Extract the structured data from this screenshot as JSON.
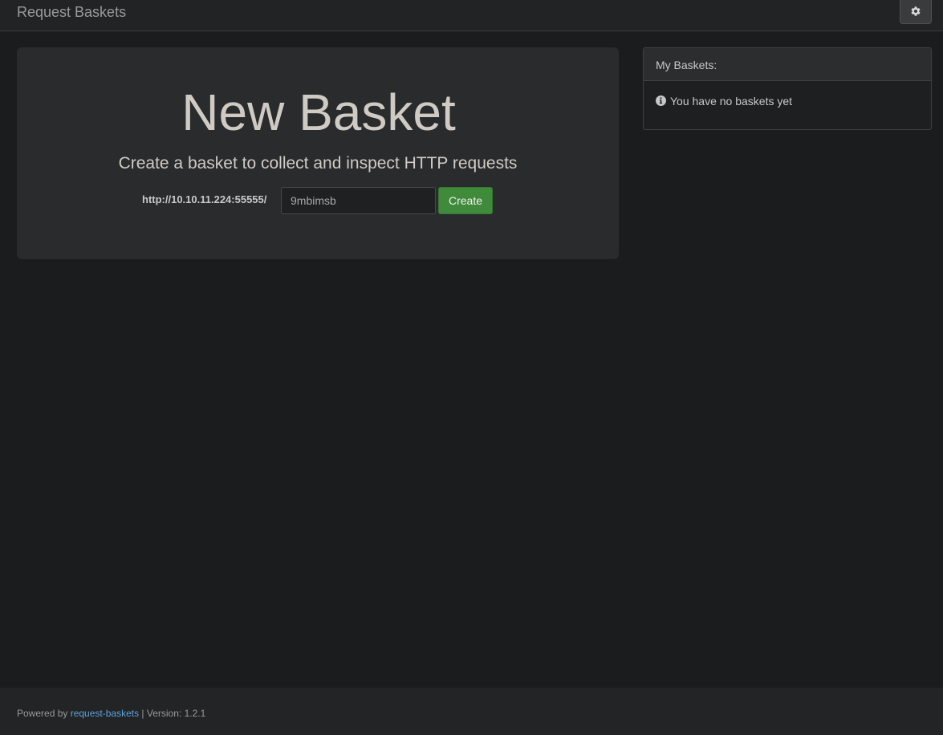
{
  "navbar": {
    "brand": "Request Baskets",
    "settings_icon": "gear-icon"
  },
  "jumbotron": {
    "title": "New Basket",
    "subtitle": "Create a basket to collect and inspect HTTP requests",
    "url_prefix": "http://10.10.11.224:55555/",
    "basket_name_value": "9mbimsb",
    "create_label": "Create"
  },
  "panel": {
    "heading": "My Baskets:",
    "info_icon": "info-circle-icon",
    "empty_message": "You have no baskets yet"
  },
  "footer": {
    "powered_by": "Powered by",
    "link_text": "request-baskets",
    "version_text": " | Version: 1.2.1"
  },
  "colors": {
    "background": "#1b1c1e",
    "create_button": "#3f8a3b",
    "link": "#5da2d8"
  }
}
